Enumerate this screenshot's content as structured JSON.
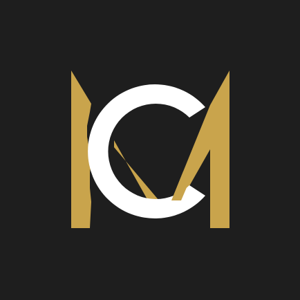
{
  "logo": {
    "monogram": "MC",
    "icon": "mc-monogram-logo-icon"
  },
  "colors": {
    "background": "#1e1e1e",
    "gold": "#c9a44c",
    "white": "#ffffff"
  }
}
